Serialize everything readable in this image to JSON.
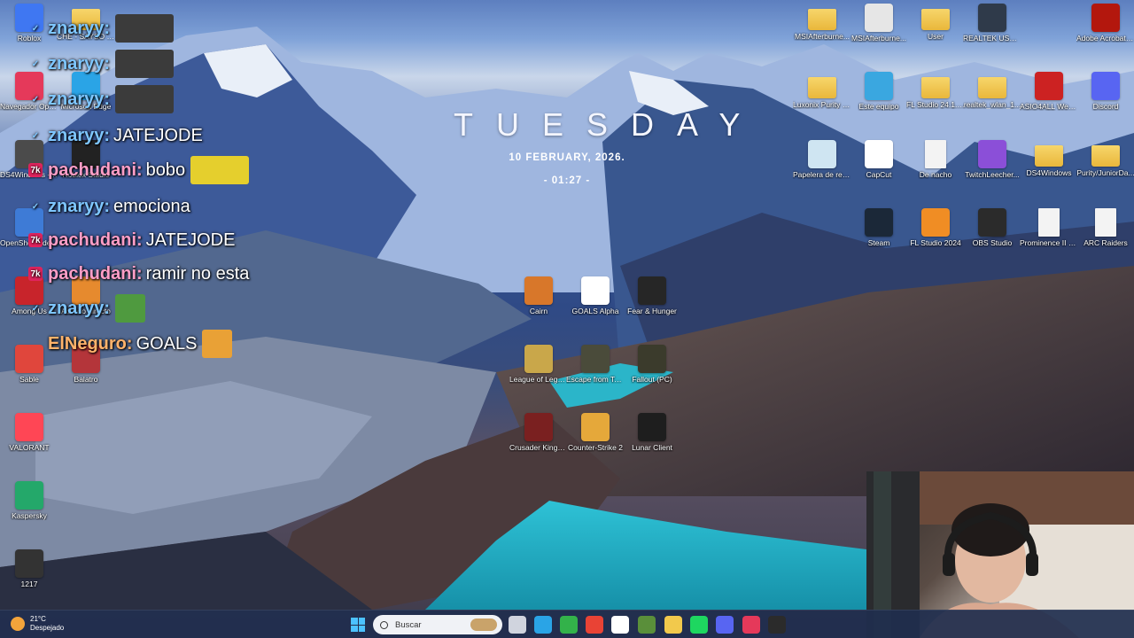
{
  "clock": {
    "day": "TUESDAY",
    "date": "10   FEBRUARY,  2026.",
    "time": "- 01:27 -"
  },
  "desktop_icons": [
    {
      "label": "Roblox",
      "color": "#3f77f2",
      "icon": "roblox-icon",
      "kind": "app"
    },
    {
      "label": "CHE - SAYSO SAYS SOUN...",
      "color": "#f2c94c",
      "icon": "folder-icon",
      "kind": "folder"
    },
    {
      "label": "Navegador Opera GX",
      "color": "#e5395a",
      "icon": "opera-gx-icon",
      "kind": "app"
    },
    {
      "label": "Microsoft Edge",
      "color": "#2aa4e6",
      "icon": "edge-icon",
      "kind": "app"
    },
    {
      "label": "DS4Windows - Acceso directo",
      "color": "#4b4b4b",
      "icon": "ds4windows-icon",
      "kind": "app"
    },
    {
      "label": "Roblox Studio",
      "color": "#222222",
      "icon": "roblox-studio-icon",
      "kind": "app"
    },
    {
      "label": "OpenShot Video Editor",
      "color": "#3e7bd6",
      "icon": "openshot-icon",
      "kind": "app"
    },
    {
      "label": "Among Us",
      "color": "#c8242b",
      "icon": "among-us-icon",
      "kind": "app"
    },
    {
      "label": "Acceso directo",
      "color": "#e68a2e",
      "icon": "shortcut-icon",
      "kind": "app"
    },
    {
      "label": "Sable",
      "color": "#e0463c",
      "icon": "sable-icon",
      "kind": "app"
    },
    {
      "label": "Balatro",
      "color": "#b4353a",
      "icon": "balatro-icon",
      "kind": "app"
    },
    {
      "label": "VALORANT",
      "color": "#ff4655",
      "icon": "valorant-icon",
      "kind": "app"
    },
    {
      "label": "Kaspersky",
      "color": "#24a86a",
      "icon": "kaspersky-icon",
      "kind": "app"
    },
    {
      "label": "1217",
      "color": "#333333",
      "icon": "file-1217-icon",
      "kind": "app"
    },
    {
      "label": "Cairn",
      "color": "#d8772a",
      "icon": "cairn-icon",
      "kind": "app"
    },
    {
      "label": "GOALS Alpha",
      "color": "#ffffff",
      "icon": "goals-icon",
      "kind": "app"
    },
    {
      "label": "Fear & Hunger",
      "color": "#262626",
      "icon": "fear-hunger-icon",
      "kind": "app"
    },
    {
      "label": "League of Legends",
      "color": "#c9a74a",
      "icon": "league-icon",
      "kind": "app"
    },
    {
      "label": "Escape from Tarkov",
      "color": "#4a4b3a",
      "icon": "tarkov-icon",
      "kind": "app"
    },
    {
      "label": "Fallout (PC)",
      "color": "#3b3b2c",
      "icon": "fallout-icon",
      "kind": "app"
    },
    {
      "label": "Crusader Kings III",
      "color": "#7a2020",
      "icon": "crusader-kings-icon",
      "kind": "app"
    },
    {
      "label": "Counter-Strike 2",
      "color": "#e5a83a",
      "icon": "cs2-icon",
      "kind": "app"
    },
    {
      "label": "Lunar Client",
      "color": "#1e1e1e",
      "icon": "lunar-client-icon",
      "kind": "app"
    },
    {
      "label": "MSIAfterburne...",
      "color": "#f2c94c",
      "icon": "folder-icon",
      "kind": "folder"
    },
    {
      "label": "MSIAfterburne...",
      "color": "#e6e6e6",
      "icon": "installer-icon",
      "kind": "app"
    },
    {
      "label": "User",
      "color": "#f2c94c",
      "icon": "folder-icon",
      "kind": "folder"
    },
    {
      "label": "REALTEK USB Wireless LA...",
      "color": "#2f3a4a",
      "icon": "realtek-icon",
      "kind": "app"
    },
    {
      "label": "Adobe Acrobat DC",
      "color": "#b3170d",
      "icon": "acrobat-icon",
      "kind": "app"
    },
    {
      "label": "Luxonix Purity 1.12",
      "color": "#f2c94c",
      "icon": "folder-icon",
      "kind": "folder"
    },
    {
      "label": "Este equipo",
      "color": "#3aa7e0",
      "icon": "this-pc-icon",
      "kind": "app"
    },
    {
      "label": "FL Studio 24.1.1 Producer Editi...",
      "color": "#f2c94c",
      "icon": "folder-icon",
      "kind": "folder"
    },
    {
      "label": "realtek_wlan_1...",
      "color": "#f2c94c",
      "icon": "folder-icon",
      "kind": "folder"
    },
    {
      "label": "ASIO4ALL Web Site",
      "color": "#cc2222",
      "icon": "asio4all-icon",
      "kind": "app"
    },
    {
      "label": "Discord",
      "color": "#5865f2",
      "icon": "discord-icon",
      "kind": "app"
    },
    {
      "label": "Papelera de reciclaje",
      "color": "#cfe5f2",
      "icon": "recycle-bin-icon",
      "kind": "app"
    },
    {
      "label": "CapCut",
      "color": "#ffffff",
      "icon": "capcut-icon",
      "kind": "app"
    },
    {
      "label": "De nacho",
      "color": "#f3f3f3",
      "icon": "document-icon",
      "kind": "doc"
    },
    {
      "label": "TwitchLeecher...",
      "color": "#8b4fd8",
      "icon": "twitch-leecher-icon",
      "kind": "app"
    },
    {
      "label": "DS4Windows",
      "color": "#f2c94c",
      "icon": "folder-icon",
      "kind": "folder"
    },
    {
      "label": "Purity/JuniorDa...",
      "color": "#f2c94c",
      "icon": "folder-icon",
      "kind": "folder"
    },
    {
      "label": "Steam",
      "color": "#1b2838",
      "icon": "steam-icon",
      "kind": "app"
    },
    {
      "label": "FL Studio 2024",
      "color": "#f08d24",
      "icon": "fl-studio-icon",
      "kind": "app"
    },
    {
      "label": "OBS Studio",
      "color": "#2b2b2b",
      "icon": "obs-icon",
      "kind": "app"
    },
    {
      "label": "Prominence II RPG Hasturi...",
      "color": "#f3f3f3",
      "icon": "document-icon",
      "kind": "doc"
    },
    {
      "label": "ARC Raiders",
      "color": "#f3f3f3",
      "icon": "document-icon",
      "kind": "doc"
    }
  ],
  "chat": [
    {
      "user": "znaryy",
      "sep": ":",
      "msg": "",
      "color": "#7ec6ff",
      "emote": true
    },
    {
      "user": "znaryy",
      "sep": ":",
      "msg": "",
      "color": "#7ec6ff",
      "emote": true
    },
    {
      "user": "znaryy",
      "sep": ":",
      "msg": "",
      "color": "#7ec6ff",
      "emote": true
    },
    {
      "user": "znaryy",
      "sep": ":",
      "msg": "JATEJODE",
      "color": "#7ec6ff",
      "emote": false
    },
    {
      "user": "pachudani",
      "sep": ":",
      "msg": "bobo",
      "color": "#ff9ec7",
      "emote": true
    },
    {
      "user": "znaryy",
      "sep": ":",
      "msg": "emociona",
      "color": "#7ec6ff",
      "emote": false
    },
    {
      "user": "pachudani",
      "sep": ":",
      "msg": "JATEJODE",
      "color": "#ff9ec7",
      "emote": false
    },
    {
      "user": "pachudani",
      "sep": ":",
      "msg": "ramir no esta",
      "color": "#ff9ec7",
      "emote": false
    },
    {
      "user": "znaryy",
      "sep": ":",
      "msg": "",
      "color": "#7ec6ff",
      "emote": true
    },
    {
      "user": "ElNeguro",
      "sep": ":",
      "msg": "GOALS",
      "color": "#ffb36b",
      "emote": true
    }
  ],
  "taskbar": {
    "weather_temp": "21°C",
    "weather_desc": "Despejado",
    "search_placeholder": "Buscar",
    "apps": [
      {
        "icon": "task-view-icon",
        "color": "#d0d4de"
      },
      {
        "icon": "edge-icon",
        "color": "#2aa4e6"
      },
      {
        "icon": "xbox-icon",
        "color": "#33b24a"
      },
      {
        "icon": "chrome-icon",
        "color": "#e94335"
      },
      {
        "icon": "xbox-app-icon",
        "color": "#ffffff"
      },
      {
        "icon": "minecraft-icon",
        "color": "#5a8f3a"
      },
      {
        "icon": "file-explorer-icon",
        "color": "#f2c94c"
      },
      {
        "icon": "spotify-icon",
        "color": "#1ed760"
      },
      {
        "icon": "discord-icon",
        "color": "#5865f2"
      },
      {
        "icon": "opera-gx-icon",
        "color": "#e5395a"
      },
      {
        "icon": "obs-icon",
        "color": "#2b2b2b"
      }
    ]
  }
}
